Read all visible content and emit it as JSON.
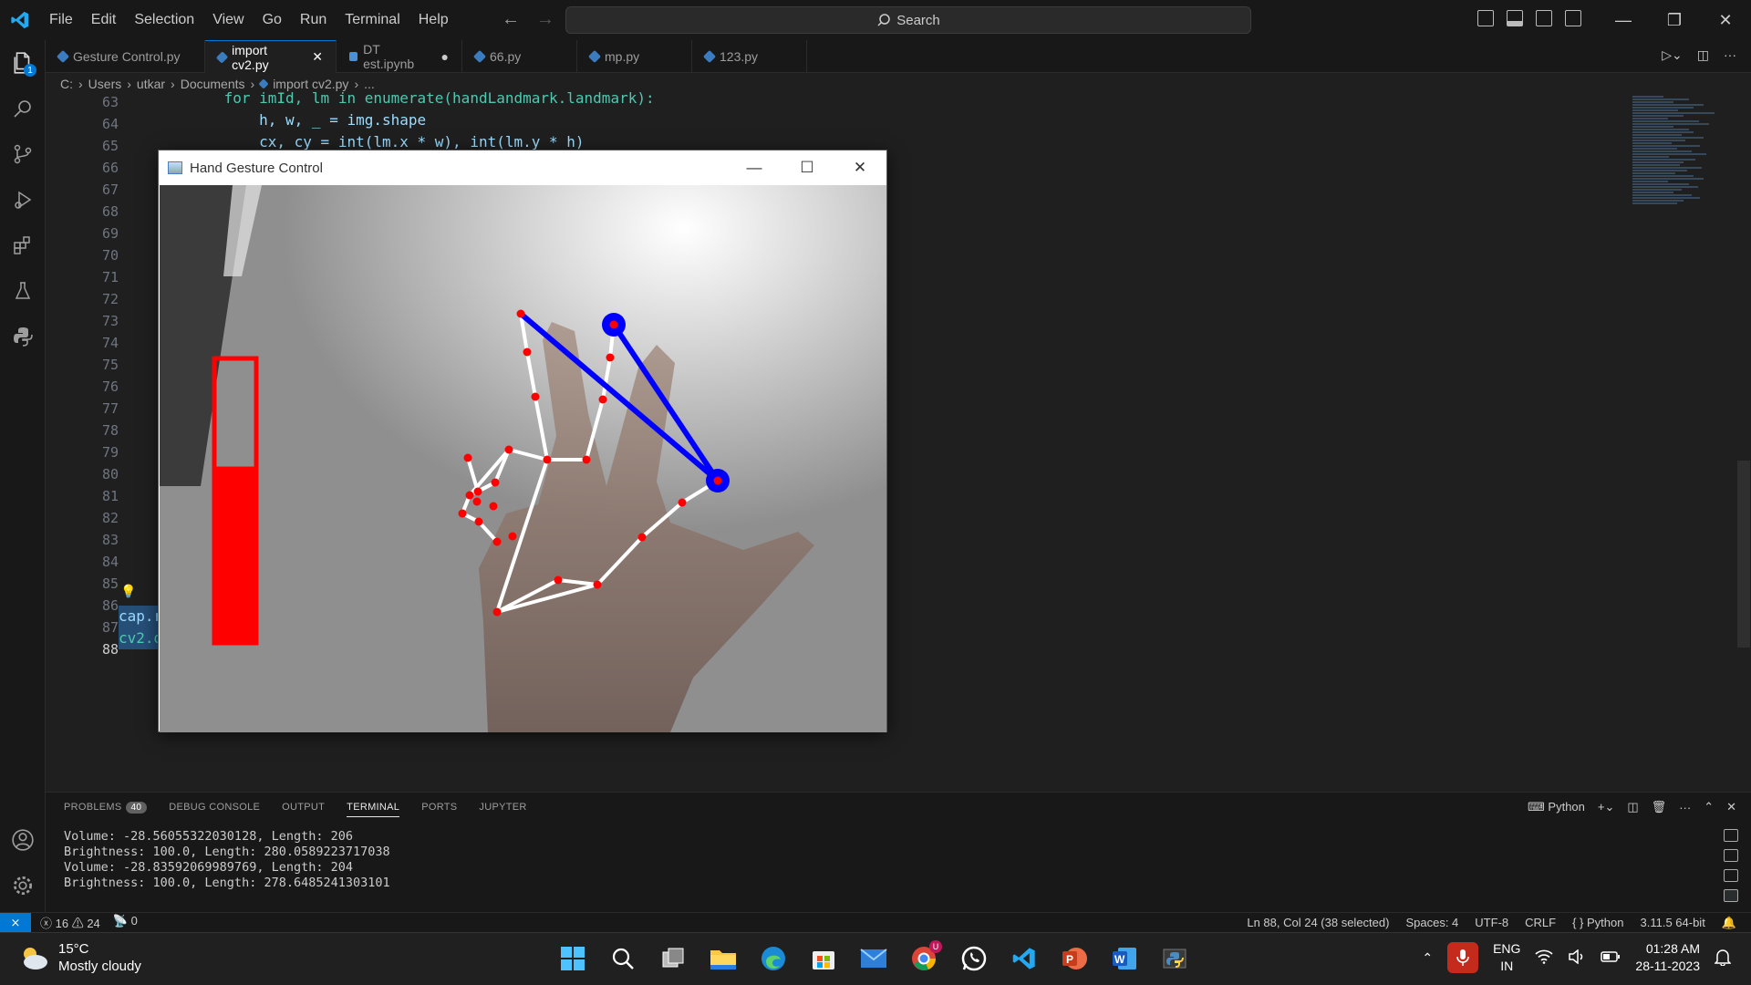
{
  "menu": [
    "File",
    "Edit",
    "Selection",
    "View",
    "Go",
    "Run",
    "Terminal",
    "Help"
  ],
  "search": {
    "label": "Search"
  },
  "tabs": [
    {
      "label": "Gesture Control.py",
      "active": false
    },
    {
      "label": "import cv2.py",
      "active": true
    },
    {
      "label": "DT est.ipynb",
      "active": false
    },
    {
      "label": "66.py",
      "active": false
    },
    {
      "label": "mp.py",
      "active": false
    },
    {
      "label": "123.py",
      "active": false
    }
  ],
  "tab_close": "✕",
  "tab_dirty": "●",
  "breadcrumb": [
    "C:",
    "Users",
    "utkar",
    "Documents",
    "import cv2.py",
    "..."
  ],
  "activity_badge": "1",
  "line_numbers": [
    "63",
    "64",
    "65",
    "66",
    "67",
    "68",
    "69",
    "70",
    "71",
    "72",
    "73",
    "74",
    "75",
    "76",
    "77",
    "78",
    "79",
    "80",
    "81",
    "82",
    "83",
    "84",
    "85",
    "86",
    "87",
    "88"
  ],
  "code": {
    "l63": "            for imId, lm in enumerate(handLandmark.landmark):",
    "l64": "                h, w, _ = img.shape",
    "l65": "                cx, cy = int(lm.x * w), int(lm.y * h)",
    "l87": "cap.r",
    "l88": "cv2.d"
  },
  "cv_window": {
    "title": "Hand Gesture Control",
    "level_fraction": 0.62
  },
  "panel": {
    "tabs": [
      "PROBLEMS",
      "DEBUG CONSOLE",
      "OUTPUT",
      "TERMINAL",
      "PORTS",
      "JUPYTER"
    ],
    "problems_count": "40",
    "active_tab": "TERMINAL",
    "shell": "Python",
    "terminal_lines": [
      "Volume: -28.56055322030128, Length: 206",
      "Brightness: 100.0, Length: 280.0589223717038",
      "Volume: -28.83592069989769, Length: 204",
      "Brightness: 100.0, Length: 278.6485241303101"
    ]
  },
  "statusbar": {
    "errors": "16",
    "warnings": "24",
    "ports": "0",
    "position": "Ln 88, Col 24 (38 selected)",
    "spaces": "Spaces: 4",
    "encoding": "UTF-8",
    "eol": "CRLF",
    "language": "Python",
    "interpreter": "3.11.5 64-bit"
  },
  "taskbar": {
    "temp": "15°C",
    "weather": "Mostly cloudy",
    "lang1": "ENG",
    "lang2": "IN",
    "time": "01:28 AM",
    "date": "28-11-2023",
    "chrome_badge": "U"
  },
  "colors": {
    "accent": "#0078d4",
    "landmark": "#ff0000",
    "connector": "#0000ff",
    "bar": "#ff0000"
  }
}
